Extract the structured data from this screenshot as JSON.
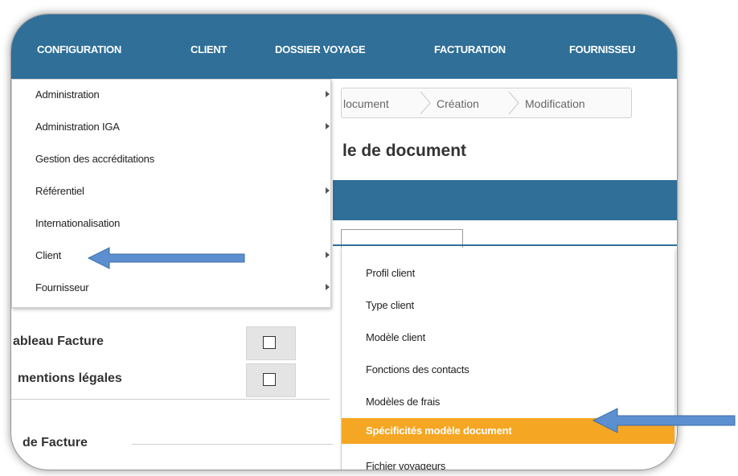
{
  "nav": {
    "items": [
      "CONFIGURATION",
      "CLIENT",
      "DOSSIER VOYAGE",
      "FACTURATION",
      "FOURNISSEU"
    ]
  },
  "breadcrumb": [
    "locument",
    "Création",
    "Modification"
  ],
  "page_title": "le de document",
  "config_menu": {
    "items": [
      {
        "label": "Administration",
        "submenu": true
      },
      {
        "label": "Administration IGA",
        "submenu": true
      },
      {
        "label": "Gestion des accréditations",
        "submenu": false
      },
      {
        "label": "Référentiel",
        "submenu": true
      },
      {
        "label": "Internationalisation",
        "submenu": false
      },
      {
        "label": "Client",
        "submenu": true
      },
      {
        "label": "Fournisseur",
        "submenu": true
      }
    ]
  },
  "client_submenu": {
    "items": [
      {
        "label": "Profil client"
      },
      {
        "label": "Type client"
      },
      {
        "label": "Modèle client"
      },
      {
        "label": "Fonctions des contacts"
      },
      {
        "label": "Modèles de frais"
      },
      {
        "label": "Spécificités modèle document",
        "active": true
      },
      {
        "label": "Fichier voyageurs"
      }
    ]
  },
  "form": {
    "label_tableau": "ableau Facture",
    "label_mentions": "mentions légales",
    "section_facture": "de Facture"
  },
  "colors": {
    "nav_bg": "#2f6f98",
    "highlight": "#f5a623",
    "arrow": "#5b8fcf"
  }
}
